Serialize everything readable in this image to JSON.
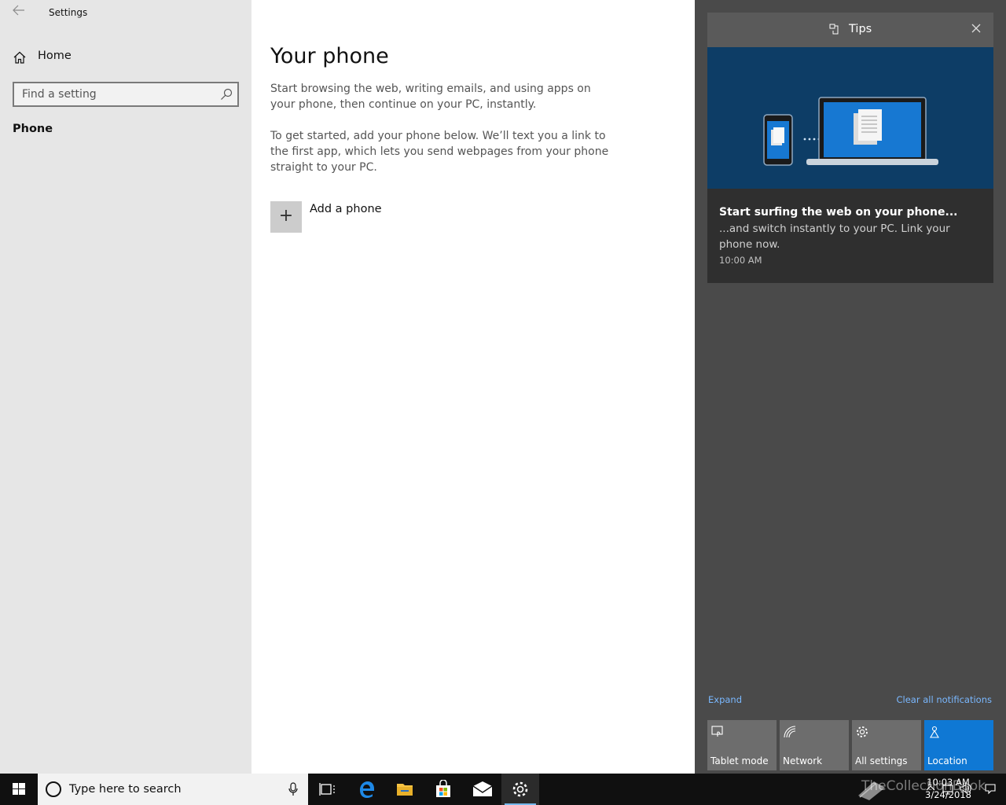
{
  "settings": {
    "window_title": "Settings",
    "home_label": "Home",
    "search_placeholder": "Find a setting",
    "nav_selected": "Phone"
  },
  "main": {
    "title": "Your phone",
    "paragraph1": "Start browsing the web, writing emails, and using apps on your phone, then continue on your PC, instantly.",
    "paragraph2": "To get started, add your phone below. We’ll text you a link to the first app, which lets you send webpages from your phone straight to your PC.",
    "add_phone_label": "Add a phone"
  },
  "action_center": {
    "notification": {
      "app": "Tips",
      "title": "Start surfing the web on your phone...",
      "body": "...and switch instantly to your PC. Link your phone now.",
      "time": "10:00 AM"
    },
    "expand_label": "Expand",
    "clear_label": "Clear all notifications",
    "quick_actions": [
      {
        "label": "Tablet mode",
        "icon": "tablet-mode-icon",
        "active": false
      },
      {
        "label": "Network",
        "icon": "network-icon",
        "active": false
      },
      {
        "label": "All settings",
        "icon": "gear-icon",
        "active": false
      },
      {
        "label": "Location",
        "icon": "location-icon",
        "active": true
      }
    ],
    "active_color": "#0f78d4"
  },
  "taskbar": {
    "search_placeholder": "Type here to search",
    "apps": [
      "task-view-icon",
      "edge-icon",
      "file-explorer-icon",
      "store-icon",
      "mail-icon",
      "settings-icon"
    ],
    "time": "10:03 AM",
    "date": "3/24/2018",
    "watermark": "TheCollectionBook"
  }
}
